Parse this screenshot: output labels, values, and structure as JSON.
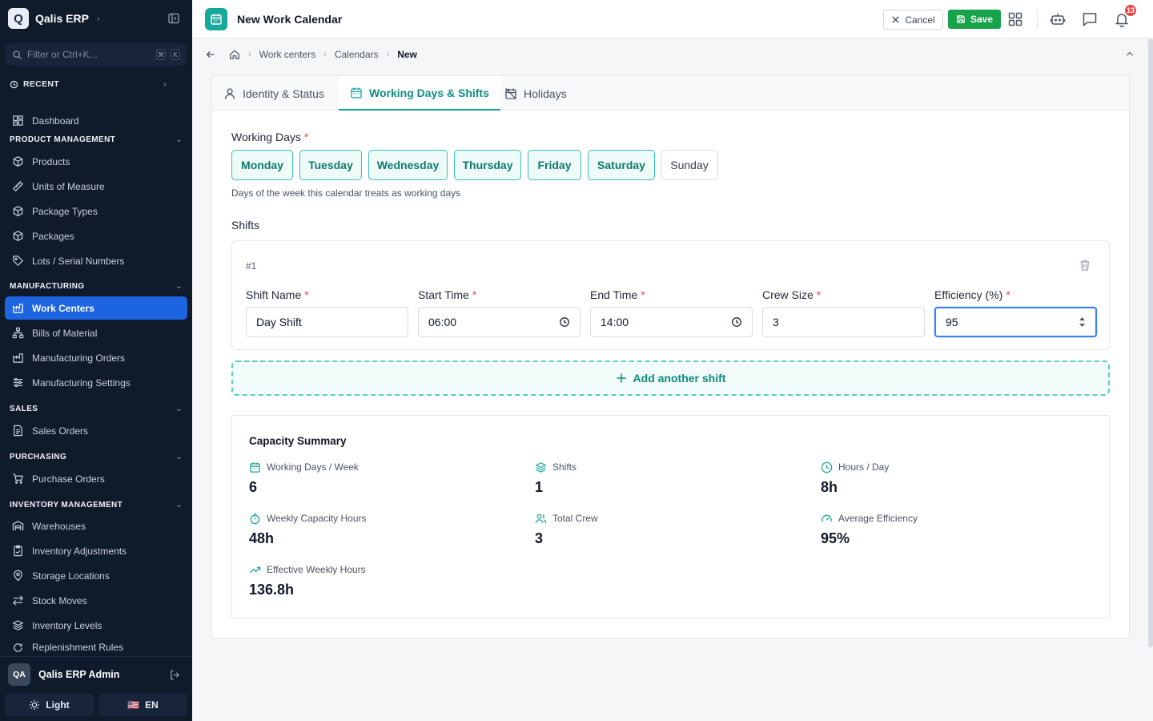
{
  "app": {
    "name": "Qalis ERP",
    "logo_letter": "Q"
  },
  "sidebar": {
    "filter_placeholder": "Filter or Ctrl+K...",
    "shortcut_keys": [
      "⌘",
      "K"
    ],
    "recent_label": "RECENT",
    "dashboard_label": "Dashboard",
    "sections": [
      {
        "title": "PRODUCT MANAGEMENT",
        "items": [
          "Products",
          "Units of Measure",
          "Package Types",
          "Packages",
          "Lots / Serial Numbers"
        ]
      },
      {
        "title": "MANUFACTURING",
        "items": [
          "Work Centers",
          "Bills of Material",
          "Manufacturing Orders",
          "Manufacturing Settings"
        ]
      },
      {
        "title": "SALES",
        "items": [
          "Sales Orders"
        ]
      },
      {
        "title": "PURCHASING",
        "items": [
          "Purchase Orders"
        ]
      },
      {
        "title": "INVENTORY MANAGEMENT",
        "items": [
          "Warehouses",
          "Inventory Adjustments",
          "Storage Locations",
          "Stock Moves",
          "Inventory Levels",
          "Replenishment Rules"
        ]
      }
    ],
    "active_item": "Work Centers",
    "user": {
      "initials": "QA",
      "name": "Qalis ERP Admin"
    },
    "theme_label": "Light",
    "language_flag": "🇺🇸",
    "language_label": "EN"
  },
  "header": {
    "title": "New Work Calendar",
    "cancel_label": "Cancel",
    "save_label": "Save",
    "notification_count": "13",
    "accent_color": "#17a99b",
    "save_color": "#16a34a"
  },
  "breadcrumb": {
    "items": [
      "Work centers",
      "Calendars"
    ],
    "current": "New"
  },
  "tabs": [
    {
      "label": "Identity & Status",
      "active": false
    },
    {
      "label": "Working Days & Shifts",
      "active": true
    },
    {
      "label": "Holidays",
      "active": false
    }
  ],
  "working_days": {
    "label": "Working Days",
    "help": "Days of the week this calendar treats as working days",
    "days": [
      {
        "label": "Monday",
        "selected": true
      },
      {
        "label": "Tuesday",
        "selected": true
      },
      {
        "label": "Wednesday",
        "selected": true
      },
      {
        "label": "Thursday",
        "selected": true
      },
      {
        "label": "Friday",
        "selected": true
      },
      {
        "label": "Saturday",
        "selected": true
      },
      {
        "label": "Sunday",
        "selected": false
      }
    ]
  },
  "shifts": {
    "label": "Shifts",
    "items": [
      {
        "number": "#1",
        "fields": {
          "name_label": "Shift Name",
          "name_value": "Day Shift",
          "start_label": "Start Time",
          "start_value": "06:00",
          "end_label": "End Time",
          "end_value": "14:00",
          "crew_label": "Crew Size",
          "crew_value": "3",
          "efficiency_label": "Efficiency (%)",
          "efficiency_value": "95"
        }
      }
    ],
    "add_label": "Add another shift"
  },
  "summary": {
    "title": "Capacity Summary",
    "stats": [
      {
        "label": "Working Days / Week",
        "value": "6",
        "icon": "calendar-icon"
      },
      {
        "label": "Shifts",
        "value": "1",
        "icon": "layers-icon"
      },
      {
        "label": "Hours / Day",
        "value": "8h",
        "icon": "clock-icon"
      },
      {
        "label": "Weekly Capacity Hours",
        "value": "48h",
        "icon": "timer-icon"
      },
      {
        "label": "Total Crew",
        "value": "3",
        "icon": "users-icon"
      },
      {
        "label": "Average Efficiency",
        "value": "95%",
        "icon": "gauge-icon"
      },
      {
        "label": "Effective Weekly Hours",
        "value": "136.8h",
        "icon": "trending-up-icon"
      }
    ]
  }
}
